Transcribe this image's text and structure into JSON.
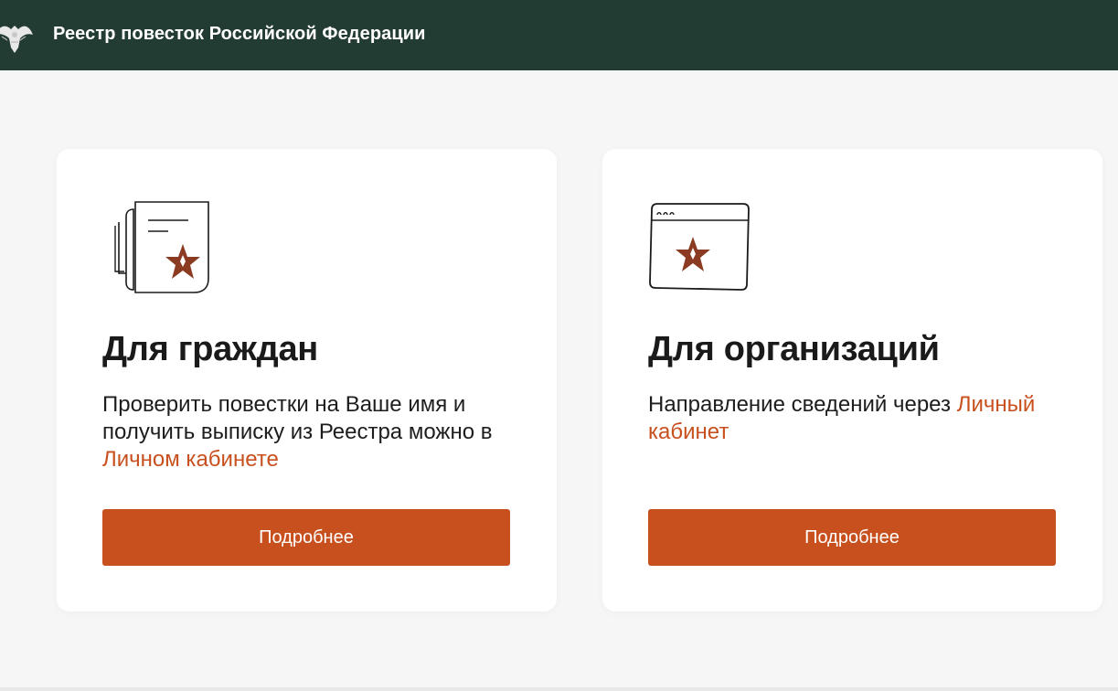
{
  "header": {
    "title": "Реестр повесток Российской Федерации",
    "logo_icon": "double-headed-eagle-emblem-icon",
    "background_color": "#233c33"
  },
  "cards": [
    {
      "icon": "document-star-icon",
      "title": "Для граждан",
      "text_before_link": "Проверить повестки на Ваше имя и получить выписку из Реестра можно в ",
      "link_text": "Личном кабинете",
      "button_label": "Подробнее"
    },
    {
      "icon": "browser-window-star-icon",
      "title": "Для организаций",
      "text_before_link": "Направление сведений через ",
      "link_text": "Личный кабинет",
      "button_label": "Подробнее"
    }
  ],
  "colors": {
    "accent": "#c8501e",
    "star": "#8a3b22",
    "page_background": "#f6f6f6",
    "card_background": "#ffffff"
  }
}
